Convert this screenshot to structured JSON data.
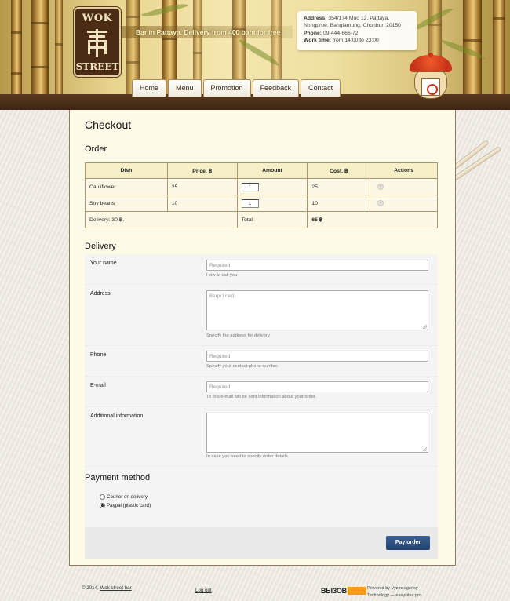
{
  "header": {
    "logo_top": "WOK",
    "logo_bottom": "STREET",
    "tagline": "Bar in Pattaya. Delivery from 400 baht for free",
    "info": {
      "address_label": "Address:",
      "address_line1": "354/174 Moo 12, Pattaya,",
      "address_line2": "Nongprue, Banglamung, Chonburi 20150",
      "phone_label": "Phone:",
      "phone": "09-444-666-72",
      "hours_label": "Work time:",
      "hours": "from 14:00 to 23:00"
    },
    "nav": [
      "Home",
      "Menu",
      "Promotion",
      "Feedback",
      "Contact"
    ]
  },
  "checkout": {
    "title": "Checkout",
    "order_heading": "Order",
    "columns": [
      "Dish",
      "Price, ฿",
      "Amount",
      "Cost, ฿",
      "Actions"
    ],
    "rows": [
      {
        "dish": "Cauliflower",
        "price": "25",
        "amount": "1",
        "cost": "25"
      },
      {
        "dish": "Soy beans",
        "price": "10",
        "amount": "1",
        "cost": "10"
      }
    ],
    "delivery_text": "Delivery: 30 ฿.",
    "total_label": "Total:",
    "total_value": "65 ฿"
  },
  "delivery": {
    "heading": "Delivery",
    "fields": {
      "name": {
        "label": "Your name",
        "placeholder": "Required",
        "hint": "How to call you"
      },
      "address": {
        "label": "Address",
        "placeholder": "Required",
        "hint": "Specify the address for delivery"
      },
      "phone": {
        "label": "Phone",
        "placeholder": "Required",
        "hint": "Specify your contact phone number."
      },
      "email": {
        "label": "E-mail",
        "placeholder": "Required",
        "hint": "To this e-mail will be sent information about your order."
      },
      "additional": {
        "label": "Additional information",
        "placeholder": "",
        "hint": "In case you need to specify order details."
      }
    }
  },
  "payment": {
    "heading": "Payment method",
    "options": [
      "Courier on delivery",
      "Paypal (plastic card)"
    ],
    "selected": "Paypal (plastic card)",
    "button": "Pay order"
  },
  "footer": {
    "copyright_prefix": "© 2014,",
    "copyright_link": "Wok street bar",
    "logout": "Log out",
    "brand": "ВЫЗОВ",
    "powered_line1": "Powered by Vyzov agency",
    "powered_line2": "Technology — easysites.pro"
  },
  "colors": {
    "header_brown": "#3e2613",
    "panel": "#fefae8",
    "table_head": "#f6efc8",
    "pay_button": "#2c4c7e",
    "brand_orange": "#f39a16"
  }
}
